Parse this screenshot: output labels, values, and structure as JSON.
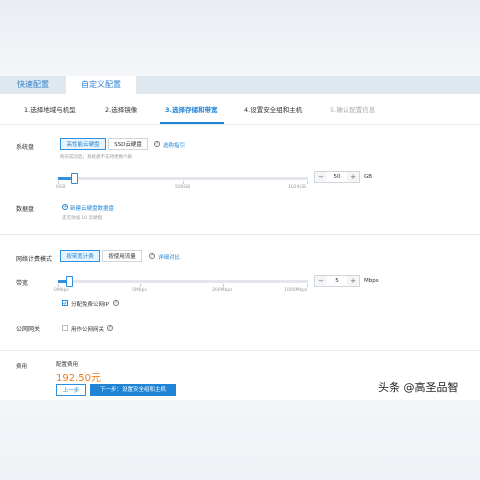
{
  "tabs": [
    {
      "label": "快速配置"
    },
    {
      "label": "自定义配置"
    }
  ],
  "steps": [
    {
      "label": "1.选择地域与机型"
    },
    {
      "label": "2.选择镜像"
    },
    {
      "label": "3.选择存储和带宽"
    },
    {
      "label": "4.设置安全组和主机"
    },
    {
      "label": "5.确认配置信息"
    }
  ],
  "system_disk": {
    "label": "系统盘",
    "options": [
      "高性能云硬盘",
      "SSD云硬盘"
    ],
    "selected": "高性能云硬盘",
    "help_link": "选购指引",
    "note": "购买成功后，系统盘不支持更换介质",
    "ticks": [
      "0GB",
      "500GB",
      "1024GB"
    ],
    "value": "50",
    "unit": "GB",
    "fraction": 0.05
  },
  "data_disk": {
    "label": "数据盘",
    "add_link": "新建云硬盘数据盘",
    "note": "还可添加 10 云硬盘"
  },
  "billing": {
    "label": "网络计费模式",
    "options": [
      "按带宽计费",
      "按使用流量"
    ],
    "selected": "按带宽计费",
    "compare_link": "详细对比"
  },
  "bandwidth": {
    "label": "带宽",
    "ticks": [
      "0Mbps",
      "5Mbps",
      "200Mbps",
      "1000Mbps"
    ],
    "value": "5",
    "unit": "Mbps",
    "fraction": 0.04,
    "assign_ip_label": "分配免费公网IP",
    "assign_ip_checked": true
  },
  "public_gateway": {
    "label": "公网网关",
    "checkbox_label": "用作公网网关",
    "checked": false
  },
  "fee": {
    "label": "费用",
    "config_label": "配置费用",
    "price": "192.50元"
  },
  "footer": {
    "prev_label": "上一步",
    "next_label": "下一步：设置安全组和主机"
  },
  "watermark": "头条 @高圣品智",
  "colors": {
    "accent": "#1f84d6",
    "price": "#f07a15"
  }
}
